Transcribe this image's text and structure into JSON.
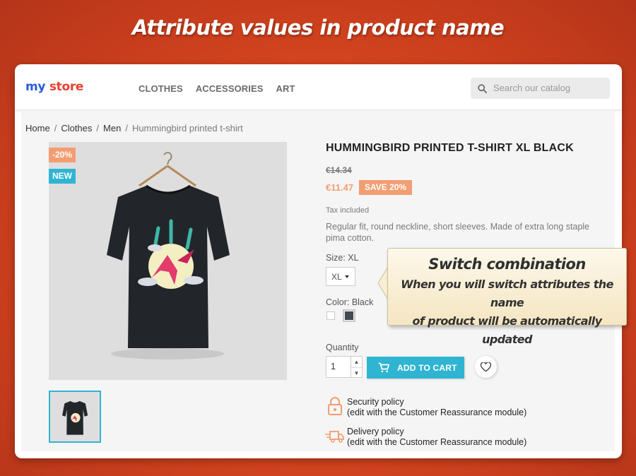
{
  "banner": {
    "title": "Attribute values in product name"
  },
  "header": {
    "logo": {
      "my": "my",
      "store": "store"
    },
    "nav": [
      "CLOTHES",
      "ACCESSORIES",
      "ART"
    ],
    "search": {
      "placeholder": "Search our catalog",
      "value": ""
    }
  },
  "breadcrumb": {
    "items": [
      "Home",
      "Clothes",
      "Men"
    ],
    "current": "Hummingbird printed t-shirt"
  },
  "product": {
    "badges": {
      "discount": "-20%",
      "new": "NEW"
    },
    "title": "HUMMINGBIRD PRINTED T-SHIRT XL BLACK",
    "old_price": "€14.34",
    "price": "€11.47",
    "save": "SAVE 20%",
    "tax": "Tax included",
    "description": "Regular fit, round neckline, short sleeves. Made of extra long staple pima cotton.",
    "size_label": "Size: XL",
    "size_selected": "XL",
    "color_label": "Color: Black",
    "colors": [
      "#ffffff",
      "#414a52"
    ],
    "quantity_label": "Quantity",
    "quantity": "1",
    "add_to_cart": "ADD TO CART"
  },
  "policies": [
    {
      "title": "Security policy",
      "note": "(edit with the Customer Reassurance module)"
    },
    {
      "title": "Delivery policy",
      "note": "(edit with the Customer Reassurance module)"
    }
  ],
  "callout": {
    "title": "Switch combination",
    "line1": "When you will switch attributes the name",
    "line2": "of product will be automatically updated"
  },
  "colors": {
    "accent": "#2fb5d2",
    "sale": "#f39d72",
    "brand_bg": "#d9481f"
  }
}
